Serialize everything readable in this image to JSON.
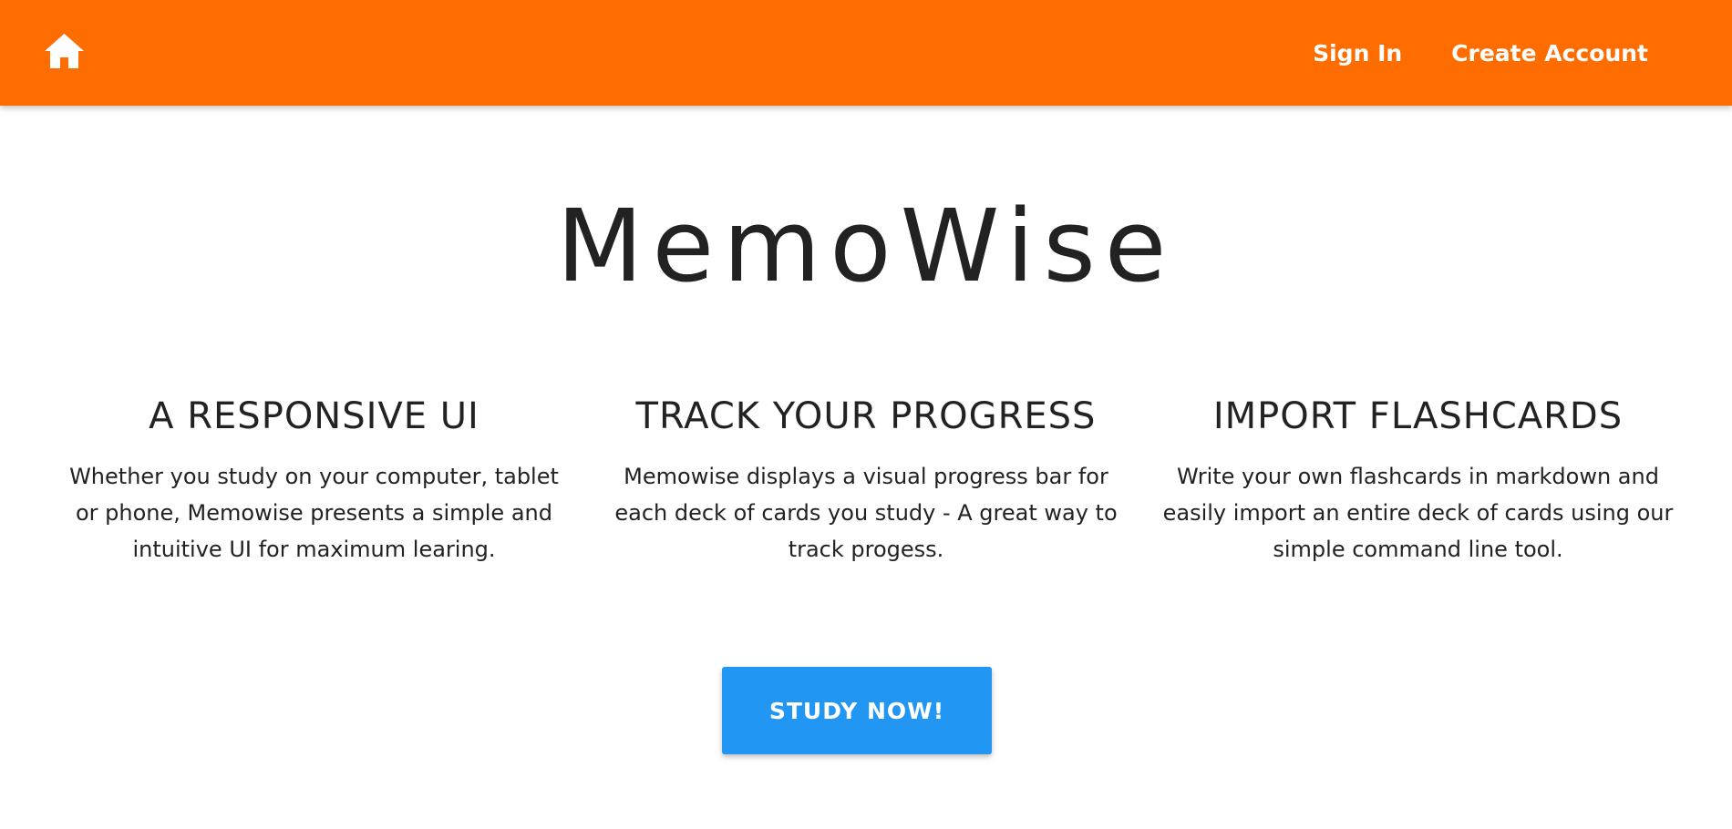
{
  "navbar": {
    "background_color": "#ff6d00",
    "home_icon": "home-icon",
    "links": [
      {
        "label": "Sign In"
      },
      {
        "label": "Create Account"
      }
    ]
  },
  "hero": {
    "title": "MemoWise"
  },
  "features": [
    {
      "heading": "A RESPONSIVE UI",
      "text": "Whether you study on your computer, tablet or phone, Memowise presents a simple and intuitive UI for maximum learing."
    },
    {
      "heading": "TRACK YOUR PROGRESS",
      "text": "Memowise displays a visual progress bar for each deck of cards you study - A great way to track progess."
    },
    {
      "heading": "IMPORT FLASHCARDS",
      "text": "Write your own flashcards in markdown and easily import an entire deck of cards using our simple command line tool."
    }
  ],
  "cta": {
    "label": "STUDY NOW!",
    "color": "#2196f3"
  }
}
